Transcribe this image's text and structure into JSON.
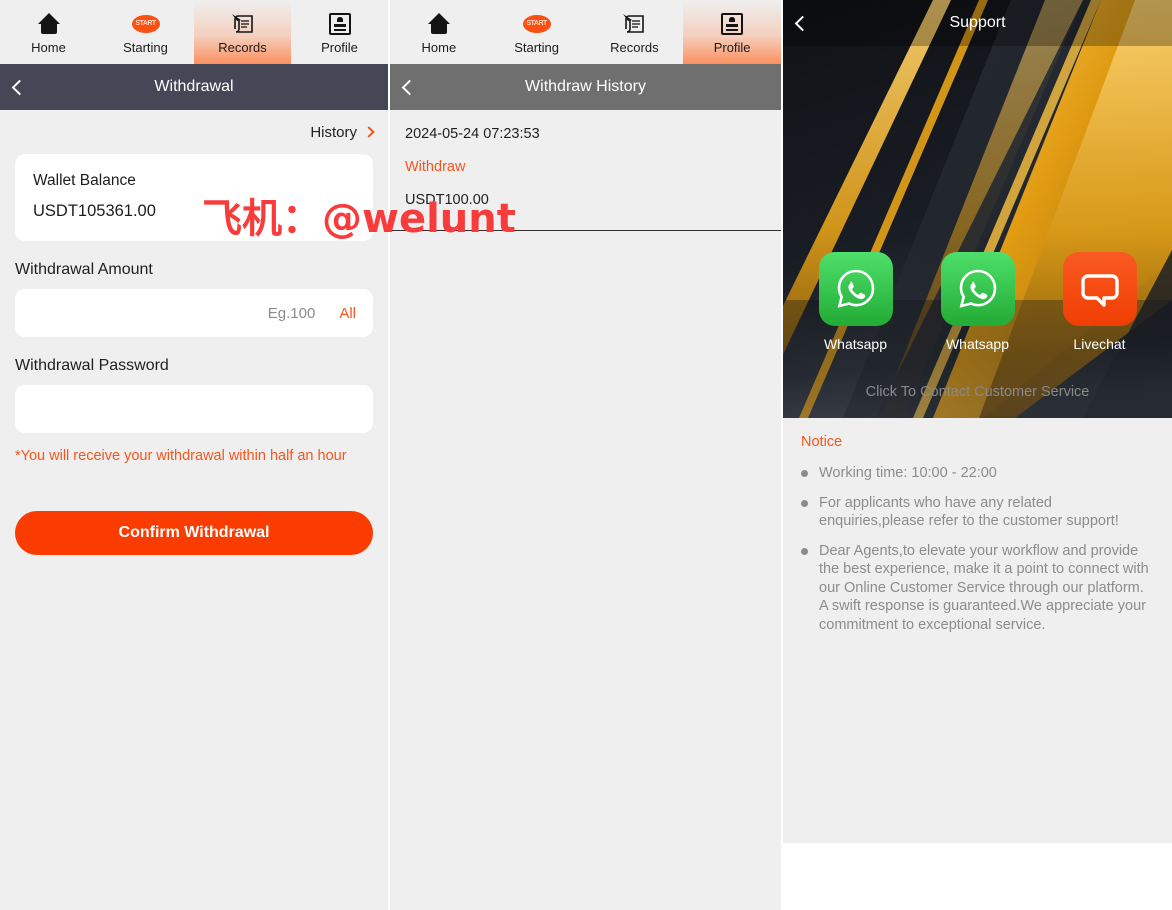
{
  "tabbars": [
    {
      "active_index": 2,
      "items": [
        {
          "label": "Home",
          "icon": "home-icon"
        },
        {
          "label": "Starting",
          "icon": "starting-oval-icon"
        },
        {
          "label": "Records",
          "icon": "records-scroll-icon"
        },
        {
          "label": "Profile",
          "icon": "profile-card-icon"
        }
      ]
    },
    {
      "active_index": 3,
      "items": [
        {
          "label": "Home",
          "icon": "home-icon"
        },
        {
          "label": "Starting",
          "icon": "starting-oval-icon"
        },
        {
          "label": "Records",
          "icon": "records-scroll-icon"
        },
        {
          "label": "Profile",
          "icon": "profile-card-icon"
        }
      ]
    }
  ],
  "withdrawal": {
    "nav_title": "Withdrawal",
    "history_link": "History",
    "wallet_label": "Wallet Balance",
    "wallet_value": "USDT105361.00",
    "amount_label": "Withdrawal Amount",
    "amount_value": "",
    "amount_placeholder": "Eg.100",
    "all_label": "All",
    "password_label": "Withdrawal Password",
    "password_value": "",
    "password_placeholder": "",
    "warning": "*You will receive your withdrawal within half an hour",
    "confirm_label": "Confirm Withdrawal"
  },
  "history": {
    "nav_title": "Withdraw History",
    "items": [
      {
        "date": "2024-05-24 07:23:53",
        "type": "Withdraw",
        "amount": "USDT100.00"
      }
    ]
  },
  "support": {
    "nav_title": "Support",
    "contacts": [
      {
        "label": "Whatsapp",
        "icon": "whatsapp-icon"
      },
      {
        "label": "Whatsapp",
        "icon": "whatsapp-icon"
      },
      {
        "label": "Livechat",
        "icon": "chat-bubble-icon"
      }
    ],
    "cta": "Click To Contact Customer Service",
    "notice_title": "Notice",
    "notice_items": [
      "Working time: 10:00 - 22:00",
      "For applicants who have any related enquiries,please refer to the customer support!",
      "Dear Agents,to elevate your workflow and provide the best experience, make it a point to connect with our Online Customer Service through our platform. A swift response is guaranteed.We appreciate your commitment to exceptional service."
    ]
  },
  "watermark": {
    "text": "飞机：@welunt"
  },
  "colors": {
    "accent_orange": "#f9541d",
    "button_orange": "#fb3c00",
    "nav_dark": "#454757",
    "nav_gray": "#6f6f6f",
    "page_bg": "#efefef",
    "whatsapp_green": "#22ab35",
    "gold": "#e8a317"
  }
}
